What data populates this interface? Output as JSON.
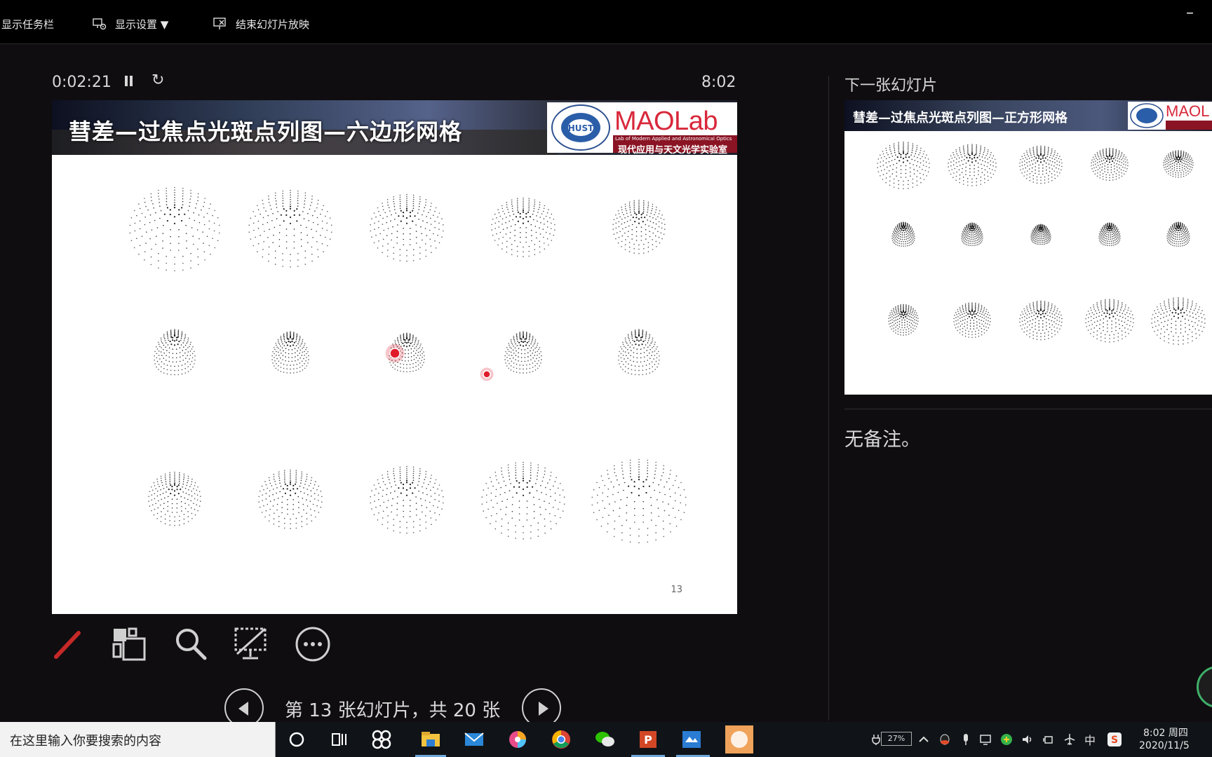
{
  "toolbar": {
    "show_taskbar": "显示任务栏",
    "display_settings": "显示设置 ▼",
    "end_show": "结束幻灯片放映",
    "minimize": "–"
  },
  "presenter": {
    "elapsed": "0:02:21",
    "clock": "8:02"
  },
  "current_slide": {
    "title": "彗差—过焦点光斑点列图—六边形网格",
    "logo_text": "MAOLab",
    "logo_sub_en": "Lab of Modern Applied and Astronomical Optics",
    "logo_sub_cn": "现代应用与天文光学实验室",
    "page_number": "13"
  },
  "tools": [
    {
      "name": "pen-tool-icon"
    },
    {
      "name": "see-all-slides-icon"
    },
    {
      "name": "zoom-icon"
    },
    {
      "name": "black-screen-icon"
    },
    {
      "name": "more-options-icon"
    }
  ],
  "navigation": {
    "counter": "第 13 张幻灯片，共 20 张"
  },
  "next_slide": {
    "label": "下一张幻灯片",
    "title": "彗差—过焦点光斑点列图—正方形网格",
    "logo_text": "MAOL"
  },
  "notes": {
    "text": "无备注。"
  },
  "taskbar": {
    "search_placeholder": "在这里输入你要搜索的内容",
    "battery": "27%",
    "ime": "中",
    "time": "8:02 周四",
    "date": "2020/11/5"
  },
  "colors": {
    "background": "#0f0d10",
    "laser_pointer": "#e01a2a",
    "logo_red": "#d8283a"
  }
}
